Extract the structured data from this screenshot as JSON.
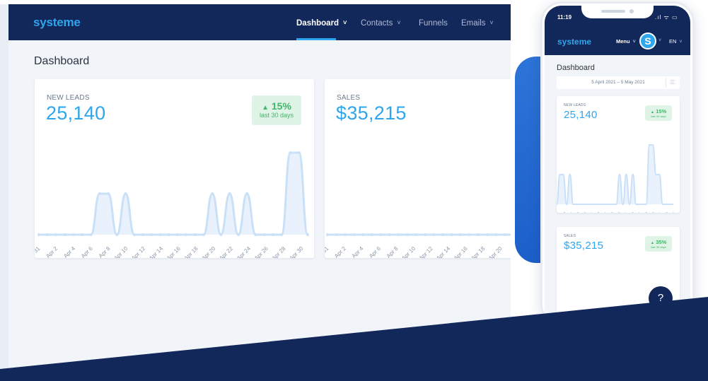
{
  "desktop": {
    "logo": "systeme",
    "nav": [
      {
        "label": "Dashboard",
        "chevron": "˅",
        "active": true
      },
      {
        "label": "Contacts",
        "chevron": "˅",
        "active": false
      },
      {
        "label": "Funnels",
        "chevron": "",
        "active": false
      },
      {
        "label": "Emails",
        "chevron": "˅",
        "active": false
      }
    ],
    "page_title": "Dashboard",
    "leads_card": {
      "label": "NEW LEADS",
      "value": "25,140",
      "trend": {
        "icon": "triangle-up-icon",
        "glyph": "▲",
        "percent": "15%",
        "caption": "last 30 days"
      }
    },
    "sales_card": {
      "label": "SALES",
      "value": "$35,215"
    }
  },
  "phone": {
    "time": "11:19",
    "status_icons": ".ıl ᯤ ▭",
    "logo": "systeme",
    "menu_label": "Menu",
    "menu_chevron": "˅",
    "avatar_letter": "S",
    "avatar_chevron": "˅",
    "language": "EN",
    "page_title": "Dashboard",
    "date_range": "5 April 2021  –  5 May 2021",
    "date_icon": "☰",
    "leads_card": {
      "label": "NEW LEADS",
      "value": "25,140",
      "trend": {
        "glyph": "▲",
        "percent": "15%",
        "caption": "last 30 days"
      }
    },
    "sales_card": {
      "label": "SALES",
      "value": "$35,215",
      "trend": {
        "glyph": "▲",
        "percent": "35%",
        "caption": "last 30 days"
      }
    },
    "help_button": "?"
  },
  "colors": {
    "navy": "#13285a",
    "accent_blue": "#2ea6ee",
    "trend_green": "#3fb66a",
    "trend_bg": "#dff4e6",
    "chart_fill": "#e3effb",
    "chart_line": "#c9e0f7"
  },
  "chart_data": [
    {
      "type": "area",
      "title": "NEW LEADS",
      "x": [
        "Mar 31",
        "Apr 1",
        "Apr 2",
        "Apr 3",
        "Apr 4",
        "Apr 5",
        "Apr 6",
        "Apr 7",
        "Apr 8",
        "Apr 9",
        "Apr 10",
        "Apr 11",
        "Apr 12",
        "Apr 13",
        "Apr 14",
        "Apr 15",
        "Apr 16",
        "Apr 17",
        "Apr 18",
        "Apr 19",
        "Apr 20",
        "Apr 21",
        "Apr 22",
        "Apr 23",
        "Apr 24",
        "Apr 25",
        "Apr 26",
        "Apr 27",
        "Apr 28",
        "Apr 29",
        "Apr 30"
      ],
      "x_tick_labels": [
        "31",
        "Apr 2",
        "Apr 4",
        "Apr 6",
        "Apr 8",
        "Apr 10",
        "Apr 12",
        "Apr 14",
        "Apr 16",
        "Apr 18",
        "Apr 20",
        "Apr 22",
        "Apr 24",
        "Apr 26",
        "Apr 28",
        "Apr 30"
      ],
      "values": [
        0,
        0,
        0,
        0,
        0,
        0,
        0,
        1,
        1,
        0,
        1,
        0,
        0,
        0,
        0,
        0,
        0,
        0,
        0,
        0,
        1,
        0,
        1,
        0,
        1,
        0,
        0,
        0,
        0,
        2,
        2,
        0
      ],
      "ylim": [
        0,
        2
      ],
      "grid": false
    },
    {
      "type": "area",
      "title": "SALES",
      "x_tick_labels": [
        "31",
        "Apr 2",
        "Apr 4",
        "Apr 6",
        "Apr 8",
        "Apr 10",
        "Apr 12",
        "Apr 14",
        "Apr 16",
        "Apr 18",
        "Apr 20",
        "Ap"
      ],
      "values": [
        0,
        0,
        0,
        0,
        0,
        0,
        0,
        0,
        0,
        0,
        0,
        0,
        0,
        0,
        0,
        0,
        0,
        0,
        0,
        0,
        0,
        0,
        0
      ],
      "ylim": [
        0,
        2
      ],
      "grid": false
    },
    {
      "type": "area",
      "title": "NEW LEADS (mobile)",
      "x_tick_labels": [
        "Apr 1",
        "Apr 3",
        "Apr 5",
        "Apr 7",
        "Apr 9",
        "Apr 11",
        "Apr 13",
        "Apr 15",
        "Apr 17",
        "Apr 19",
        "Apr 21",
        "Apr 23",
        "Apr 25",
        "Apr 27",
        "Apr 29",
        "May 1",
        "May 3",
        "May 5"
      ],
      "values": [
        0,
        1,
        1,
        0,
        1,
        0,
        0,
        0,
        0,
        0,
        0,
        0,
        0,
        0,
        0,
        0,
        0,
        0,
        0,
        1,
        0,
        1,
        0,
        1,
        0,
        0,
        0,
        0,
        2,
        2,
        1,
        1,
        0,
        0,
        0,
        0
      ],
      "ylim": [
        0,
        2
      ],
      "grid": false
    }
  ]
}
